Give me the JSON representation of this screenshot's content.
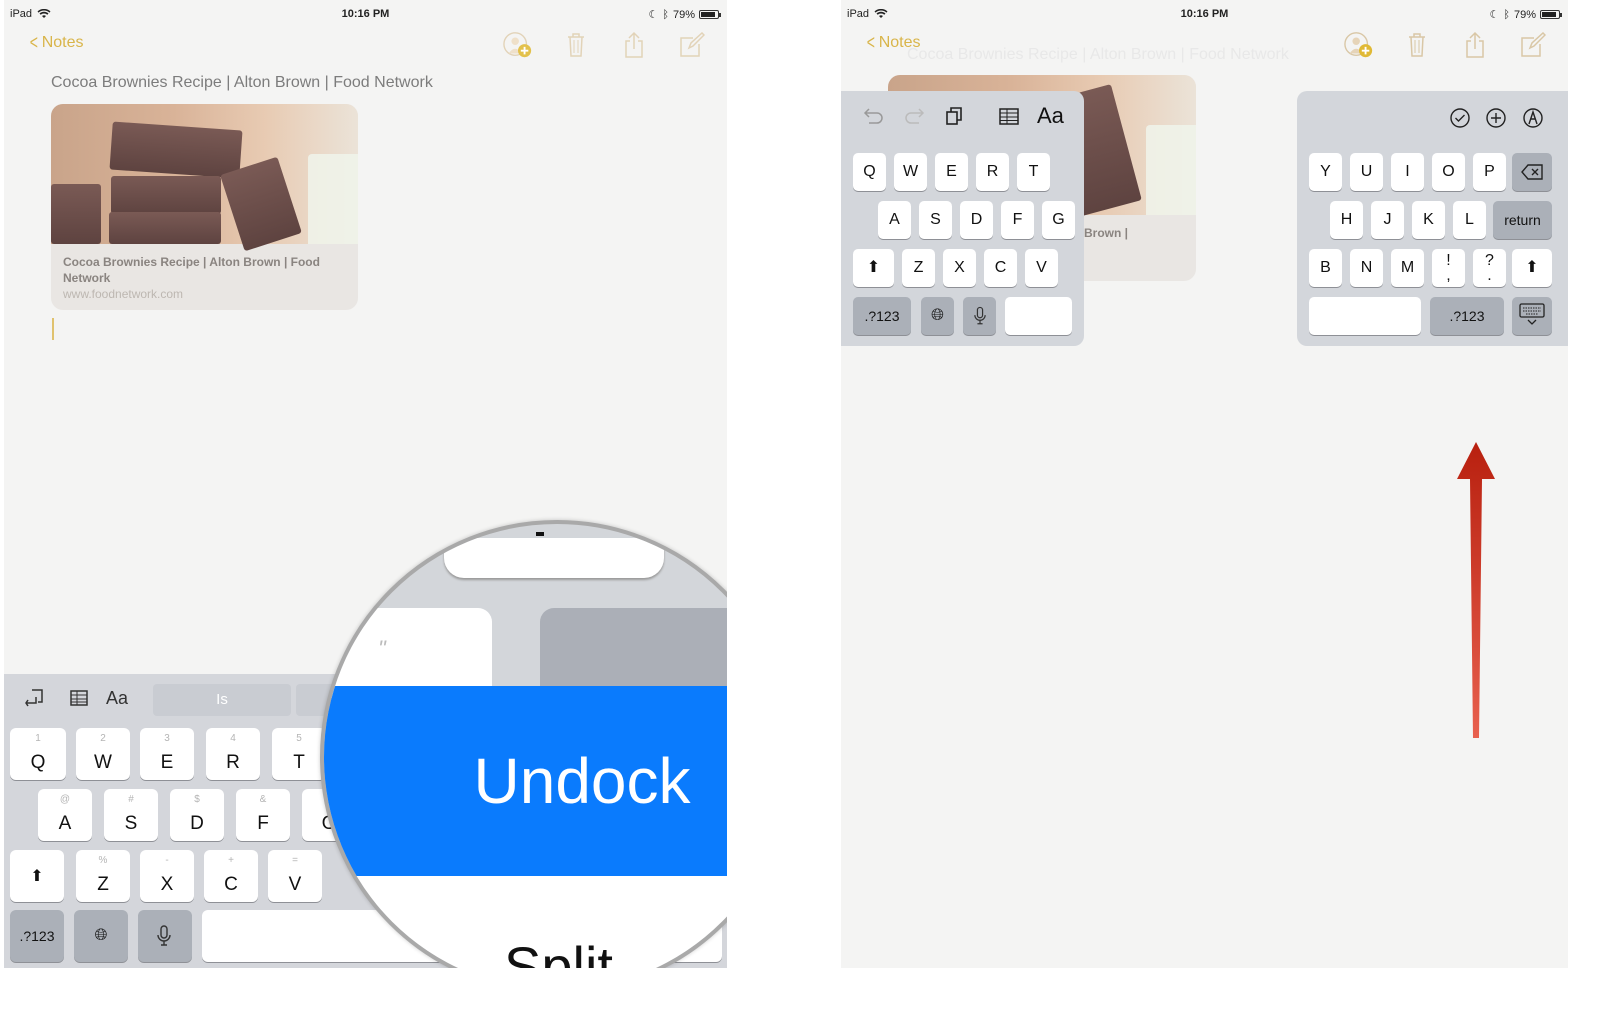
{
  "status_bar": {
    "device": "iPad",
    "time": "10:16 PM",
    "battery": "79%",
    "battery_level": 0.79
  },
  "navbar": {
    "back_label": "Notes",
    "icons": [
      "add-person-icon",
      "trash-icon",
      "share-icon",
      "compose-icon"
    ]
  },
  "note": {
    "title": "Cocoa Brownies Recipe | Alton Brown | Food Network",
    "card_title": "Cocoa Brownies Recipe | Alton Brown | Food Network",
    "card_url": "www.foodnetwork.com",
    "card_partial_text": "Brown |"
  },
  "docked_keyboard": {
    "toolbar_icons": [
      "paste-undo-icon",
      "table-icon",
      "text-format-icon"
    ],
    "format_label": "Aa",
    "prediction": "Is",
    "rows": [
      [
        {
          "k": "Q",
          "s": "1"
        },
        {
          "k": "W",
          "s": "2"
        },
        {
          "k": "E",
          "s": "3"
        },
        {
          "k": "R",
          "s": "4"
        },
        {
          "k": "T",
          "s": "5"
        }
      ],
      [
        {
          "k": "A",
          "s": "@"
        },
        {
          "k": "S",
          "s": "#"
        },
        {
          "k": "D",
          "s": "$"
        },
        {
          "k": "F",
          "s": "&"
        },
        {
          "k": "G",
          "s": ""
        }
      ],
      [
        {
          "k": "Z",
          "s": "%"
        },
        {
          "k": "X",
          "s": "-"
        },
        {
          "k": "C",
          "s": "+"
        },
        {
          "k": "V",
          "s": "="
        }
      ]
    ],
    "numbers_label": ".?123"
  },
  "magnifier": {
    "quote_glyph": "\"",
    "undock_label": "Undock",
    "split_label": "Split"
  },
  "split_keyboard": {
    "left": {
      "format_label": "Aa",
      "rows": [
        [
          "Q",
          "W",
          "E",
          "R",
          "T"
        ],
        [
          "A",
          "S",
          "D",
          "F",
          "G"
        ],
        [
          "Z",
          "X",
          "C",
          "V"
        ]
      ],
      "numbers_label": ".?123"
    },
    "right": {
      "rows": [
        [
          "Y",
          "U",
          "I",
          "O",
          "P"
        ],
        [
          "H",
          "J",
          "K",
          "L"
        ],
        [
          "B",
          "N",
          "M",
          "!\n,",
          "?\n."
        ]
      ],
      "return_label": "return",
      "numbers_label": ".?123"
    }
  },
  "colors": {
    "accent": "#d9b54a",
    "undock_blue": "#0a7bfd",
    "arrow_red": "#c8281a"
  }
}
